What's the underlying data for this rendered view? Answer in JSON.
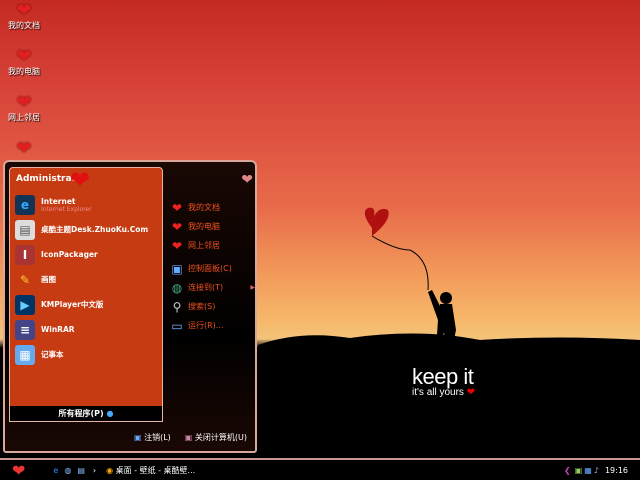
{
  "desktop": {
    "icons": [
      {
        "label": "我的文档"
      },
      {
        "label": "我的电脑"
      },
      {
        "label": "网上邻居"
      },
      {
        "label": ""
      }
    ],
    "wallpaper": {
      "title": "keep it",
      "subtitle": "it's all yours"
    }
  },
  "start_menu": {
    "user": "Administrator",
    "pinned": [
      {
        "label": "Internet",
        "sub": "Internet Explorer",
        "icon": "ie-icon"
      },
      {
        "label": "桌酷主题Desk.ZhuoKu.Com",
        "icon": "theme-icon"
      },
      {
        "label": "IconPackager",
        "icon": "iconpackager-icon"
      },
      {
        "label": "画图",
        "icon": "paint-icon"
      },
      {
        "label": "KMPlayer中文版",
        "icon": "kmplayer-icon"
      },
      {
        "label": "WinRAR",
        "icon": "winrar-icon"
      },
      {
        "label": "记事本",
        "icon": "notepad-icon"
      }
    ],
    "all_programs": "所有程序(P)",
    "right": [
      {
        "label": "我的文档"
      },
      {
        "label": "我的电脑"
      },
      {
        "label": "网上邻居"
      },
      {
        "label": "控制面板(C)"
      },
      {
        "label": "连接到(T)"
      },
      {
        "label": "搜索(S)"
      },
      {
        "label": "运行(R)..."
      }
    ],
    "logoff": "注销(L)",
    "shutdown": "关闭计算机(U)"
  },
  "taskbar": {
    "task": "桌面 - 壁纸 - 桌酷壁...",
    "clock": "19:16",
    "show_more": "›"
  },
  "colors": {
    "menu_panel": "#c63b12",
    "accent": "#f05020"
  }
}
